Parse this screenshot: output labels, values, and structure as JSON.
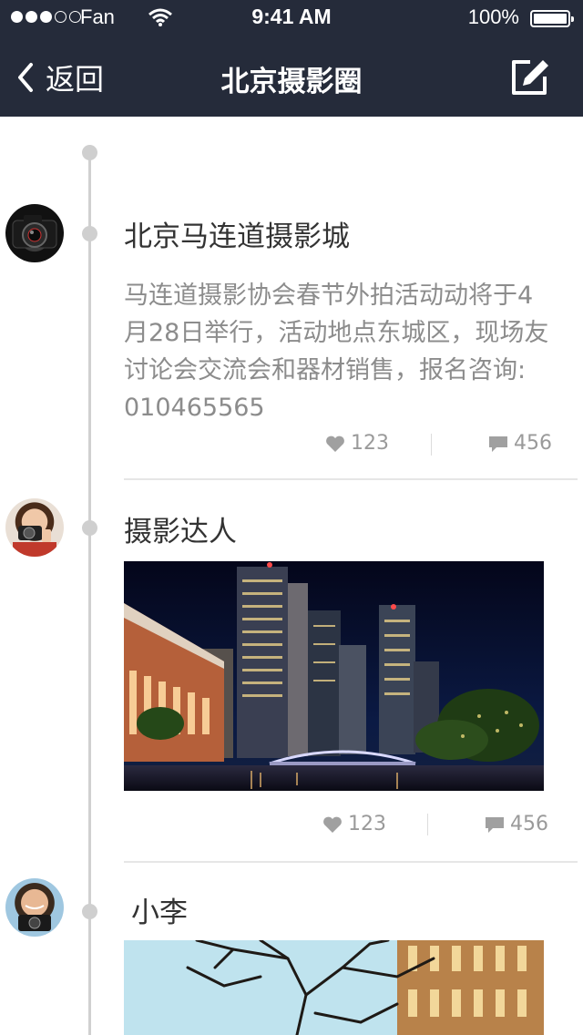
{
  "status_bar": {
    "carrier": "Fan",
    "time": "9:41 AM",
    "battery": "100%"
  },
  "nav": {
    "back_label": "返回",
    "title": "北京摄影圈",
    "icons": {
      "back": "chevron-left-icon",
      "compose": "edit-icon"
    }
  },
  "posts": [
    {
      "author": "北京马连道摄影城",
      "lines": [
        "马连道摄影协会春节外拍活动动将于4",
        "月28日举行，活动地点东城区，现场友",
        "讨论会交流会和器材销售，报名咨询:",
        "010465565"
      ],
      "likes": "123",
      "comments": "456"
    },
    {
      "author": "摄影达人",
      "likes": "123",
      "comments": "456"
    },
    {
      "author": "小李"
    }
  ],
  "colors": {
    "nav_bg": "#252b3a",
    "timeline": "#d0d0d0",
    "body_text": "#8c8c8c",
    "name_text": "#333333"
  }
}
